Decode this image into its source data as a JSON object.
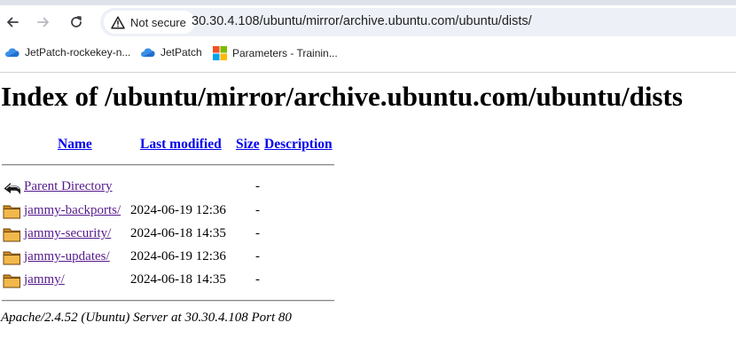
{
  "browser": {
    "security_label": "Not secure",
    "url": "30.30.4.108/ubuntu/mirror/archive.ubuntu.com/ubuntu/dists/",
    "bookmarks": [
      {
        "label": "JetPatch-rockekey-n...",
        "icon": "cloud-icon"
      },
      {
        "label": "JetPatch",
        "icon": "cloud-icon"
      },
      {
        "label": "Parameters - Trainin...",
        "icon": "microsoft-grid-icon"
      }
    ]
  },
  "page": {
    "title": "Index of /ubuntu/mirror/archive.ubuntu.com/ubuntu/dists",
    "columns": {
      "name": "Name",
      "last_modified": "Last modified",
      "size": "Size",
      "description": "Description"
    },
    "rows": [
      {
        "name": "Parent Directory",
        "modified": "",
        "size": "-",
        "icon": "back-arrow-icon"
      },
      {
        "name": "jammy-backports/",
        "modified": "2024-06-19 12:36",
        "size": "-",
        "icon": "folder-icon"
      },
      {
        "name": "jammy-security/",
        "modified": "2024-06-18 14:35",
        "size": "-",
        "icon": "folder-icon"
      },
      {
        "name": "jammy-updates/",
        "modified": "2024-06-19 12:36",
        "size": "-",
        "icon": "folder-icon"
      },
      {
        "name": "jammy/",
        "modified": "2024-06-18 14:35",
        "size": "-",
        "icon": "folder-icon"
      }
    ],
    "footer": "Apache/2.4.52 (Ubuntu) Server at 30.30.4.108 Port 80"
  },
  "colors": {
    "link": "#0000ee",
    "visited_link": "#551a8b",
    "folder": "#e8a33a"
  }
}
